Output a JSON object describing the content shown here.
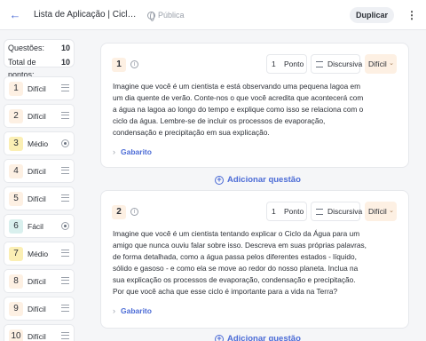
{
  "topbar": {
    "title": "Lista de Aplicação | Ciclo d...",
    "visibility": "Pública",
    "duplicate_label": "Duplicar"
  },
  "summary": {
    "questions_label": "Questões:",
    "questions_value": "10",
    "points_label": "Total de pontos:",
    "points_value": "10"
  },
  "nav": [
    {
      "num": "1",
      "label": "Difícil",
      "color": "#fdf0e3",
      "type": "lines"
    },
    {
      "num": "2",
      "label": "Difícil",
      "color": "#fdf0e3",
      "type": "lines"
    },
    {
      "num": "3",
      "label": "Médio",
      "color": "#fbefb4",
      "type": "radio"
    },
    {
      "num": "4",
      "label": "Difícil",
      "color": "#fdf0e3",
      "type": "lines"
    },
    {
      "num": "5",
      "label": "Difícil",
      "color": "#fdf0e3",
      "type": "lines"
    },
    {
      "num": "6",
      "label": "Fácil",
      "color": "#d9f0ee",
      "type": "radio"
    },
    {
      "num": "7",
      "label": "Médio",
      "color": "#fbefb4",
      "type": "lines"
    },
    {
      "num": "8",
      "label": "Difícil",
      "color": "#fdf0e3",
      "type": "lines"
    },
    {
      "num": "9",
      "label": "Difícil",
      "color": "#fdf0e3",
      "type": "lines"
    },
    {
      "num": "10",
      "label": "Difícil",
      "color": "#fdf0e3",
      "type": "lines"
    }
  ],
  "questions": [
    {
      "num": "1",
      "points": "1",
      "points_unit": "Ponto",
      "type": "Discursiva",
      "difficulty": "Difícil",
      "text": "Imagine que você é um cientista e está observando uma pequena lagoa em um dia quente de verão. Conte-nos o que você acredita que acontecerá com a água na lagoa ao longo do tempo e explique como isso se relaciona com o ciclo da água. Lembre-se de incluir os processos de evaporação, condensação e precipitação em sua explicação.",
      "answer_label": "Gabarito"
    },
    {
      "num": "2",
      "points": "1",
      "points_unit": "Ponto",
      "type": "Discursiva",
      "difficulty": "Difícil",
      "text": "Imagine que você é um cientista tentando explicar o Ciclo da Água para um amigo que nunca ouviu falar sobre isso. Descreva em suas próprias palavras, de forma detalhada, como a água passa pelos diferentes estados - líquido, sólido e gasoso - e como ela se move ao redor do nosso planeta. Inclua na sua explicação os processos de evaporação, condensação e precipitação. Por que você acha que esse ciclo é importante para a vida na Terra?",
      "answer_label": "Gabarito"
    }
  ],
  "add_question_label": "Adicionar questão"
}
